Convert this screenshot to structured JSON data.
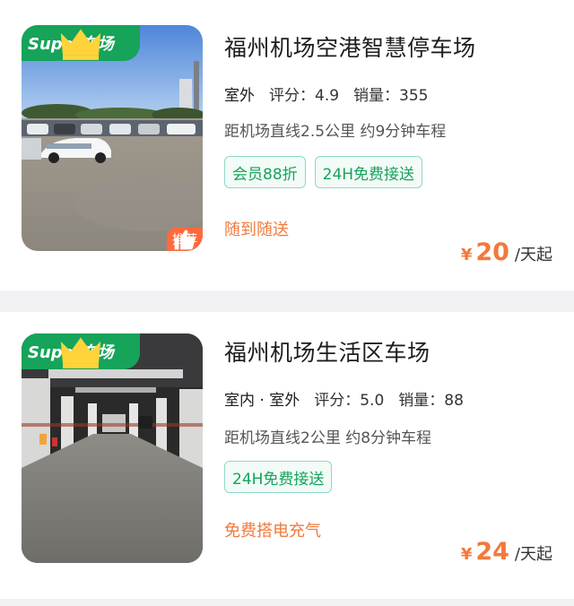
{
  "listings": [
    {
      "badge": "Super车场",
      "recommend": "推荐",
      "title": "福州机场空港智慧停车场",
      "environment": "室外",
      "rating_label": "评分：4.9",
      "sales_label": "销量：355",
      "distance": "距机场直线2.5公里 约9分钟车程",
      "tags": [
        "会员88折",
        "24H免费接送"
      ],
      "feature": "随到随送",
      "currency": "¥",
      "price": "20",
      "price_unit": "/天起"
    },
    {
      "badge": "Super车场",
      "title": "福州机场生活区车场",
      "environment": "室内 · 室外",
      "rating_label": "评分：5.0",
      "sales_label": "销量：88",
      "distance": "距机场直线2公里 约8分钟车程",
      "tags": [
        "24H免费接送"
      ],
      "feature": "免费搭电充气",
      "currency": "¥",
      "price": "24",
      "price_unit": "/天起"
    }
  ],
  "colors": {
    "brand_green": "#16a35a",
    "accent_orange": "#f3793b",
    "recommend_orange": "#ff6a3d"
  },
  "icons": {
    "badge": "crown-icon",
    "recommend": "thumbs-up-icon"
  }
}
